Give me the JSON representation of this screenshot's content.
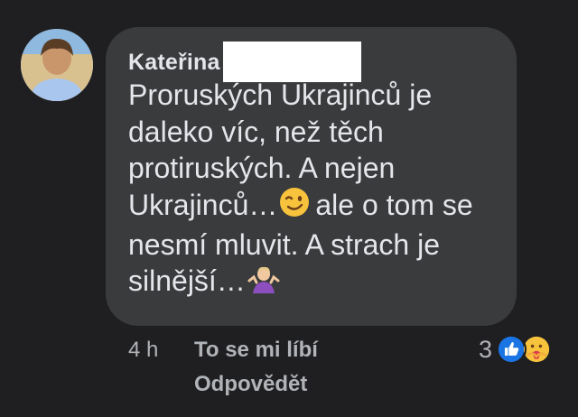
{
  "comment": {
    "author": "Kateřina",
    "lines": [
      "Proruských Ukrajinců je",
      "daleko víc, než těch",
      "protiruských. A nejen",
      "Ukrajinců…",
      "ale o tom se",
      "nesmí mluvit. A strach je",
      "silnější…"
    ]
  },
  "meta": {
    "time": "4 h",
    "like_label": "To se mi líbí",
    "reply_label": "Odpovědět",
    "reaction_count": "3"
  },
  "icons": {
    "wink": "winking-face-icon",
    "shrug": "person-shrugging-icon",
    "like": "like-reaction-icon",
    "care": "care-reaction-icon"
  },
  "colors": {
    "background": "#1f1f21",
    "bubble": "#3a3b3c",
    "text": "#e4e6eb",
    "meta": "#b0b3b8",
    "like_blue": "#1b74e4"
  }
}
